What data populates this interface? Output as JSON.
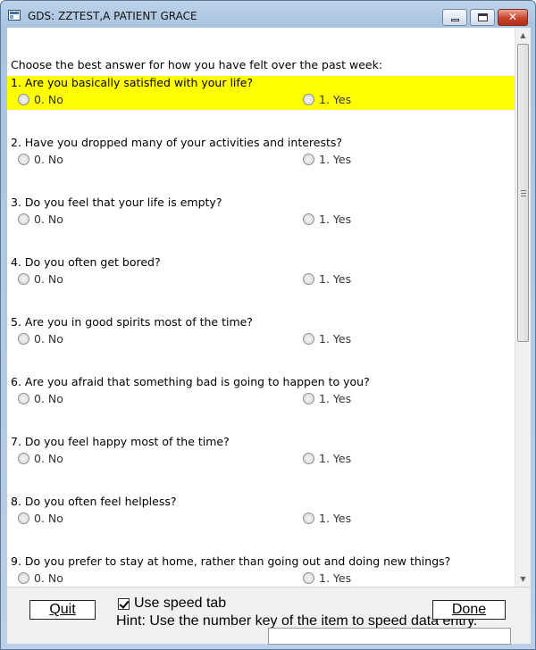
{
  "window": {
    "title": "GDS: ZZTEST,A PATIENT GRACE",
    "close_glyph": "✕"
  },
  "intro": "Choose the best answer for how you have felt over the past week:",
  "questions": [
    {
      "text": "1. Are you basically satisfied with your life?",
      "no": "0. No",
      "yes": "1. Yes"
    },
    {
      "text": "2. Have you dropped many of your activities and interests?",
      "no": "0. No",
      "yes": "1. Yes"
    },
    {
      "text": "3. Do you feel that your life is empty?",
      "no": "0. No",
      "yes": "1. Yes"
    },
    {
      "text": "4. Do you often get bored?",
      "no": "0. No",
      "yes": "1. Yes"
    },
    {
      "text": "5. Are you in good spirits most of the time?",
      "no": "0. No",
      "yes": "1. Yes"
    },
    {
      "text": "6. Are you afraid that something bad is going to happen to you?",
      "no": "0. No",
      "yes": "1. Yes"
    },
    {
      "text": "7. Do you feel happy most of the time?",
      "no": "0. No",
      "yes": "1. Yes"
    },
    {
      "text": "8. Do you often feel helpless?",
      "no": "0. No",
      "yes": "1. Yes"
    },
    {
      "text": "9. Do you prefer to stay at home, rather than going out and doing new things?",
      "no": "0. No",
      "yes": "1. Yes"
    }
  ],
  "footer": {
    "quit_label": "Quit",
    "done_label": "Done",
    "speed_tab_label": "Use speed tab",
    "speed_tab_checked": true,
    "hint": "Hint: Use the number key of the item to speed data entry."
  },
  "colors": {
    "highlight": "#ffff00"
  }
}
